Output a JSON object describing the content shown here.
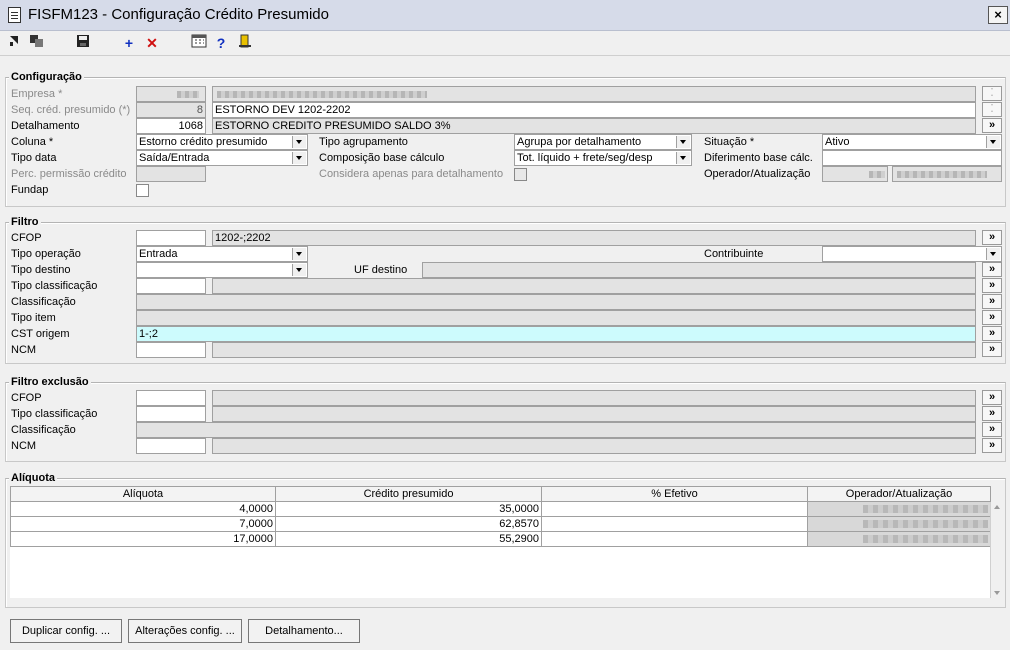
{
  "window": {
    "title": "FISFM123 - Configuração Crédito Presumido",
    "close": "×"
  },
  "toolbar": {
    "icons": [
      "toggle-icon",
      "copy-icon",
      "save-icon",
      "add-icon",
      "delete-icon",
      "calendar-icon",
      "help-icon",
      "exit-icon"
    ],
    "add": "+",
    "delete": "✕",
    "help": "?"
  },
  "config": {
    "title": "Configuração",
    "empresa_label": "Empresa *",
    "seq_label": "Seq. créd. presumido (*)",
    "seq_value": "8",
    "seq_desc": "ESTORNO DEV 1202-2202",
    "det_label": "Detalhamento",
    "det_value": "1068",
    "det_desc": "ESTORNO CREDITO PRESUMIDO SALDO 3%",
    "coluna_label": "Coluna *",
    "coluna_value": "Estorno crédito presumido",
    "tipo_agrup_label": "Tipo agrupamento",
    "tipo_agrup_value": "Agrupa por detalhamento",
    "situacao_label": "Situação *",
    "situacao_value": "Ativo",
    "tipo_data_label": "Tipo data",
    "tipo_data_value": "Saída/Entrada",
    "comp_label": "Composição base cálculo",
    "comp_value": "Tot. líquido + frete/seg/desp",
    "difer_label": "Diferimento base cálc.",
    "perc_label": "Perc. permissão crédito",
    "considera_label": "Considera apenas para detalhamento",
    "operador_label": "Operador/Atualização",
    "fundap_label": "Fundap"
  },
  "filtro": {
    "title": "Filtro",
    "cfop_label": "CFOP",
    "cfop_desc": "1202-;2202",
    "tipo_op_label": "Tipo operação",
    "tipo_op_value": "Entrada",
    "contrib_label": "Contribuinte",
    "tipo_dest_label": "Tipo destino",
    "uf_dest_label": "UF destino",
    "tipo_class_label": "Tipo classificação",
    "class_label": "Classificação",
    "tipo_item_label": "Tipo item",
    "cst_label": "CST origem",
    "cst_value": "1-;2",
    "ncm_label": "NCM"
  },
  "filtro_exclusao": {
    "title": "Filtro exclusão",
    "cfop_label": "CFOP",
    "tipo_class_label": "Tipo classificação",
    "class_label": "Classificação",
    "ncm_label": "NCM"
  },
  "aliquota": {
    "title": "Alíquota",
    "columns": [
      "Alíquota",
      "Crédito presumido",
      "% Efetivo",
      "Operador/Atualização"
    ],
    "rows": [
      {
        "aliquota": "4,0000",
        "credito": "35,0000",
        "efetivo": ""
      },
      {
        "aliquota": "7,0000",
        "credito": "62,8570",
        "efetivo": ""
      },
      {
        "aliquota": "17,0000",
        "credito": "55,2900",
        "efetivo": ""
      }
    ]
  },
  "buttons": {
    "duplicar": "Duplicar config. ...",
    "alteracoes": "Alterações config. ...",
    "detalhamento": "Detalhamento...",
    "more": "»"
  }
}
